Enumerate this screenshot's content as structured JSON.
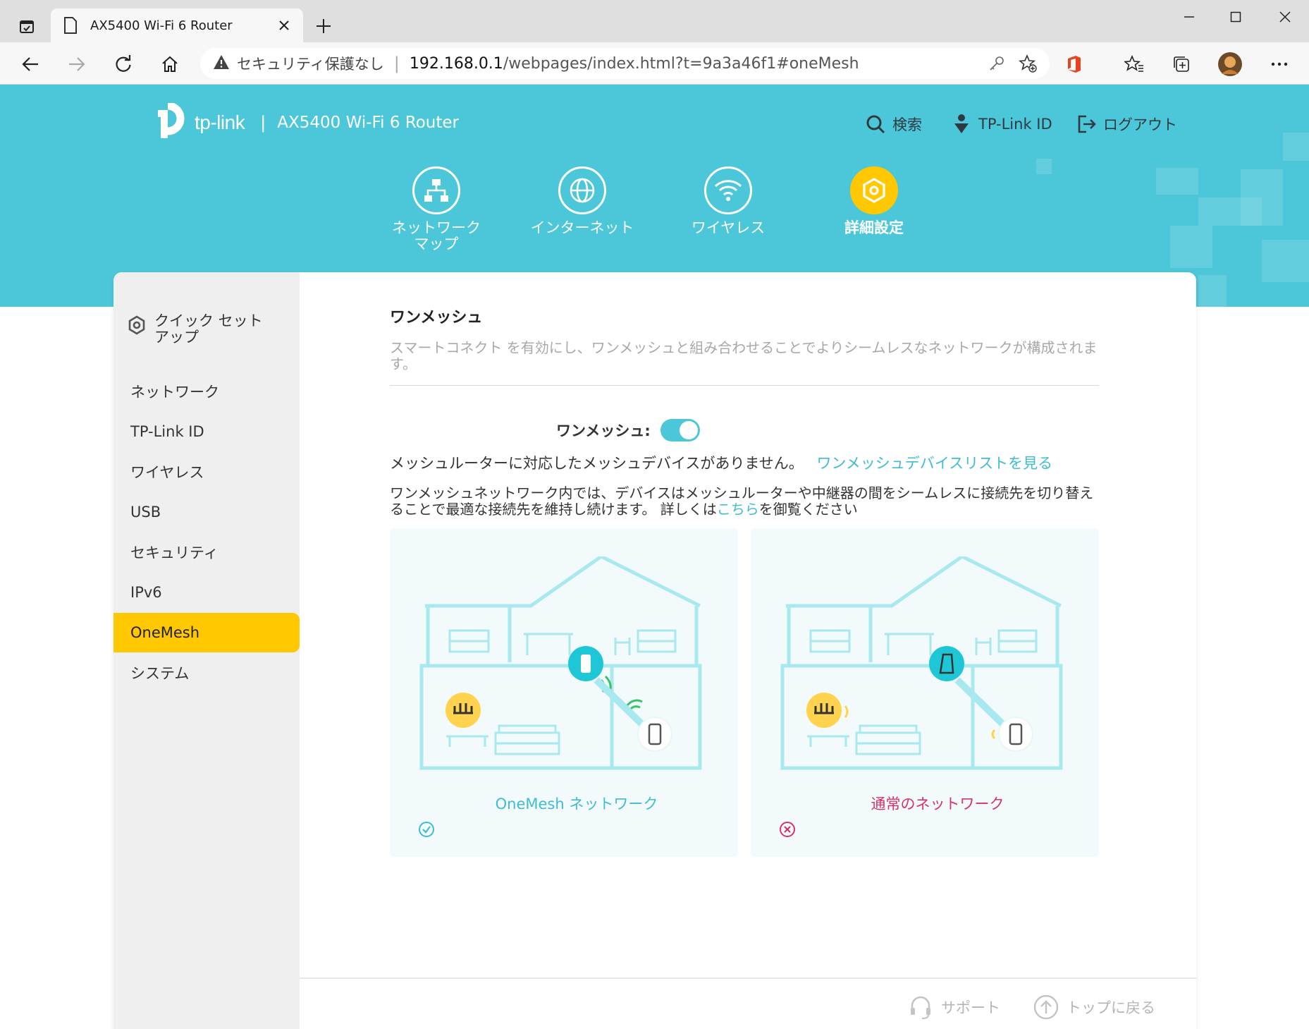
{
  "browser": {
    "tab_title": "AX5400 Wi-Fi 6 Router",
    "security_label": "セキュリティ保護なし",
    "url_host": "192.168.0.1",
    "url_path": "/webpages/index.html?t=9a3a46f1#oneMesh"
  },
  "header": {
    "brand": "tp-link",
    "product": "AX5400 Wi-Fi 6 Router",
    "search_label": "検索",
    "tplink_id_label": "TP-Link ID",
    "logout_label": "ログアウト"
  },
  "main_nav": [
    {
      "label": "ネットワーク\nマップ",
      "icon": "network-map-icon"
    },
    {
      "label": "インターネット",
      "icon": "globe-icon"
    },
    {
      "label": "ワイヤレス",
      "icon": "wifi-icon"
    },
    {
      "label": "詳細設定",
      "icon": "gear-icon",
      "active": true
    }
  ],
  "sidebar": {
    "quick_setup": "クイック セット\nアップ",
    "items": [
      {
        "label": "ネットワーク"
      },
      {
        "label": "TP-Link ID"
      },
      {
        "label": "ワイヤレス"
      },
      {
        "label": "USB"
      },
      {
        "label": "セキュリティ"
      },
      {
        "label": "IPv6"
      },
      {
        "label": "OneMesh",
        "active": true
      },
      {
        "label": "システム"
      }
    ]
  },
  "content": {
    "title": "ワンメッシュ",
    "description": "スマートコネクト を有効にし、ワンメッシュと組み合わせることでよりシームレスなネットワークが構成されます。",
    "toggle_label": "ワンメッシュ:",
    "toggle_state": "on",
    "no_device_text": "メッシュルーターに対応したメッシュデバイスがありません。",
    "device_list_link": "ワンメッシュデバイスリストを見る",
    "info_text_before": "ワンメッシュネットワーク内では、デバイスはメッシュルーターや中継器の間をシームレスに接続先を切り替えることで最適な接続先を維持し続けます。 詳しくは",
    "info_link": "こちら",
    "info_text_after": "を御覧ください",
    "panel_onemesh_caption": "OneMesh ネットワーク",
    "panel_normal_caption": "通常のネットワーク"
  },
  "footer": {
    "support_label": "サポート",
    "top_label": "トップに戻る"
  },
  "colors": {
    "accent": "#4cc7d9",
    "active": "#ffc800",
    "link": "#3fbcd3",
    "error": "#d6336c"
  }
}
